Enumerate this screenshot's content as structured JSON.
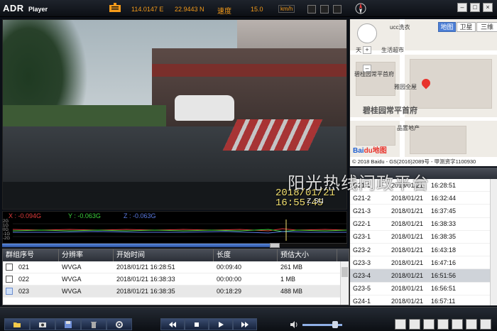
{
  "app": {
    "logo": "ADR",
    "logo_sub": "Player"
  },
  "gps": {
    "longitude": "114.0147 E",
    "latitude": "22.9443 N",
    "speed_label": "速度",
    "speed_value": "15.0",
    "speed_unit": "km/h"
  },
  "video": {
    "osd_date": "2018/01/21",
    "osd_time": "16:55:45"
  },
  "map": {
    "types": [
      "地图",
      "卫星",
      "三维"
    ],
    "active_type": "地图",
    "labels": [
      {
        "text": "ucc洗衣"
      },
      {
        "text": "天"
      },
      {
        "text": "生活超市"
      },
      {
        "text": "碧桂园常平首府"
      },
      {
        "text": "雅园全屋"
      },
      {
        "text": "碧桂园常平首府"
      },
      {
        "text": "品置地产"
      }
    ],
    "brand": {
      "bai": "Bai",
      "du": "du地图"
    },
    "copyright": "© 2018 Baidu - GS(2016)2089号 - 甲测资字1100930"
  },
  "gsensor": {
    "x": "X : -0.094G",
    "y": "Y : -0.063G",
    "z": "Z : -0.063G",
    "axis": [
      "2G",
      "1G",
      "0G",
      "-1G",
      "-2G"
    ],
    "progress": 0.79
  },
  "table": {
    "headers": [
      "群组序号",
      "分辨率",
      "开始时间",
      "长度",
      "预估大小"
    ],
    "rows": [
      {
        "id": "021",
        "resolution": "WVGA",
        "start": "2018/01/21 16:28:51",
        "length": "00:09:40",
        "size": "261 MB",
        "selected": false
      },
      {
        "id": "022",
        "resolution": "WVGA",
        "start": "2018/01/21 16:38:33",
        "length": "00:00:00",
        "size": "1 MB",
        "selected": false
      },
      {
        "id": "023",
        "resolution": "WVGA",
        "start": "2018/01/21 16:38:35",
        "length": "00:18:29",
        "size": "488 MB",
        "selected": true
      }
    ]
  },
  "events": [
    {
      "id": "G21-1",
      "date": "2018/01/21",
      "time": "16:28:51",
      "selected": false
    },
    {
      "id": "G21-2",
      "date": "2018/01/21",
      "time": "16:32:44",
      "selected": false
    },
    {
      "id": "G21-3",
      "date": "2018/01/21",
      "time": "16:37:45",
      "selected": false
    },
    {
      "id": "G22-1",
      "date": "2018/01/21",
      "time": "16:38:33",
      "selected": false
    },
    {
      "id": "G23-1",
      "date": "2018/01/21",
      "time": "16:38:35",
      "selected": false
    },
    {
      "id": "G23-2",
      "date": "2018/01/21",
      "time": "16:43:18",
      "selected": false
    },
    {
      "id": "G23-3",
      "date": "2018/01/21",
      "time": "16:47:16",
      "selected": false
    },
    {
      "id": "G23-4",
      "date": "2018/01/21",
      "time": "16:51:56",
      "selected": true
    },
    {
      "id": "G23-5",
      "date": "2018/01/21",
      "time": "16:56:51",
      "selected": false
    },
    {
      "id": "G24-1",
      "date": "2018/01/21",
      "time": "16:57:11",
      "selected": false
    }
  ],
  "watermark": {
    "main": "阳光热线问政平台",
    "sub": "z.su"
  },
  "colors": {
    "accent": "#f39a1a",
    "player_blue": "#2a4f9a",
    "map_active": "#4d7fd6",
    "pin": "#e8322b"
  },
  "toolbar": {
    "left_buttons": [
      "folder-icon",
      "camera-icon",
      "save-icon",
      "trash-icon",
      "settings-icon"
    ],
    "playback_buttons": [
      "rewind-icon",
      "stop-icon",
      "play-icon",
      "fast-forward-icon"
    ],
    "volume": 0.82
  }
}
